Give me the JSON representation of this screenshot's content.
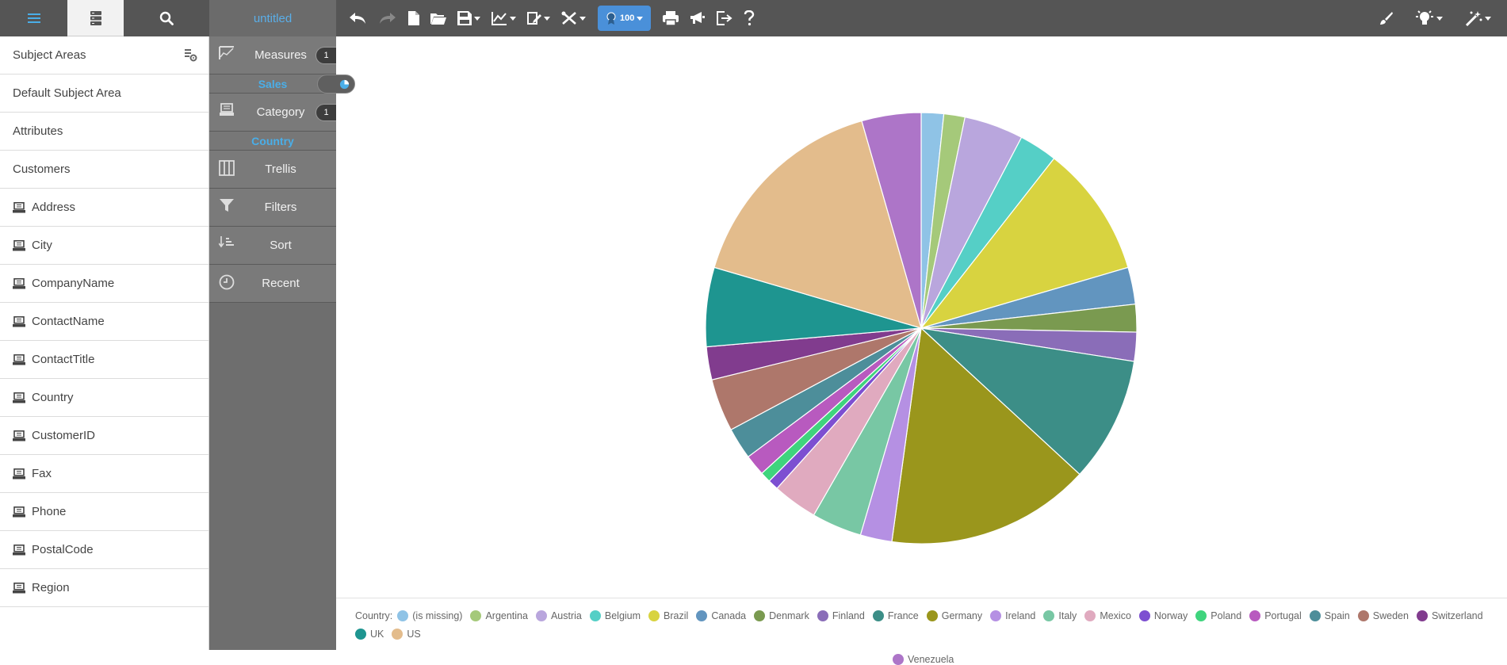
{
  "toolbar": {
    "title": "untitled",
    "zoom": "100",
    "buttons": [
      "undo-icon",
      "redo-icon",
      "new-doc-icon",
      "open-folder-icon",
      "save-icon",
      "chart-type-icon",
      "edit-icon",
      "tools-icon",
      "print-icon",
      "announce-icon",
      "export-icon",
      "help-icon"
    ],
    "right_buttons": [
      "brush-icon",
      "lightbulb-icon",
      "magic-wand-icon"
    ]
  },
  "sidebar": {
    "header": "Subject Areas",
    "items": [
      {
        "label": "Default Subject Area",
        "icon": ""
      },
      {
        "label": "Attributes",
        "icon": ""
      },
      {
        "label": "Customers",
        "icon": ""
      },
      {
        "label": "Address",
        "icon": "field-icon"
      },
      {
        "label": "City",
        "icon": "field-icon"
      },
      {
        "label": "CompanyName",
        "icon": "field-icon"
      },
      {
        "label": "ContactName",
        "icon": "field-icon"
      },
      {
        "label": "ContactTitle",
        "icon": "field-icon"
      },
      {
        "label": "Country",
        "icon": "field-icon"
      },
      {
        "label": "CustomerID",
        "icon": "field-icon"
      },
      {
        "label": "Fax",
        "icon": "field-icon"
      },
      {
        "label": "Phone",
        "icon": "field-icon"
      },
      {
        "label": "PostalCode",
        "icon": "field-icon"
      },
      {
        "label": "Region",
        "icon": "field-icon"
      }
    ]
  },
  "shelf": {
    "measures": {
      "label": "Measures",
      "count": "1",
      "value": "Sales"
    },
    "category": {
      "label": "Category",
      "count": "1",
      "value": "Country"
    },
    "trellis": "Trellis",
    "filters": "Filters",
    "sort": "Sort",
    "recent": "Recent"
  },
  "chart_data": {
    "type": "pie",
    "legend_title": "Country:",
    "legend_position": "bottom",
    "categories": [
      "(is missing)",
      "Argentina",
      "Austria",
      "Belgium",
      "Brazil",
      "Canada",
      "Denmark",
      "Finland",
      "France",
      "Germany",
      "Ireland",
      "Italy",
      "Mexico",
      "Norway",
      "Poland",
      "Portugal",
      "Spain",
      "Sweden",
      "Switzerland",
      "UK",
      "US",
      "Venezuela"
    ],
    "values": [
      1.7,
      1.6,
      4.5,
      2.9,
      10.0,
      2.8,
      2.1,
      2.2,
      9.5,
      15.5,
      2.4,
      3.8,
      3.4,
      0.8,
      0.8,
      1.6,
      2.4,
      4.0,
      2.5,
      6.0,
      16.2,
      4.5
    ],
    "colors": [
      "#8fc3e6",
      "#a5c97a",
      "#b9a6dd",
      "#55cfc6",
      "#d8d340",
      "#6295bf",
      "#7a9a50",
      "#8a6db8",
      "#3c8e87",
      "#9a961c",
      "#b590e3",
      "#78c7a4",
      "#e0aabf",
      "#7d4fd1",
      "#3fd47d",
      "#b85abf",
      "#4d8e9a",
      "#ae776b",
      "#813c8e",
      "#1e9590",
      "#e3bc8c",
      "#ad75c8"
    ]
  }
}
